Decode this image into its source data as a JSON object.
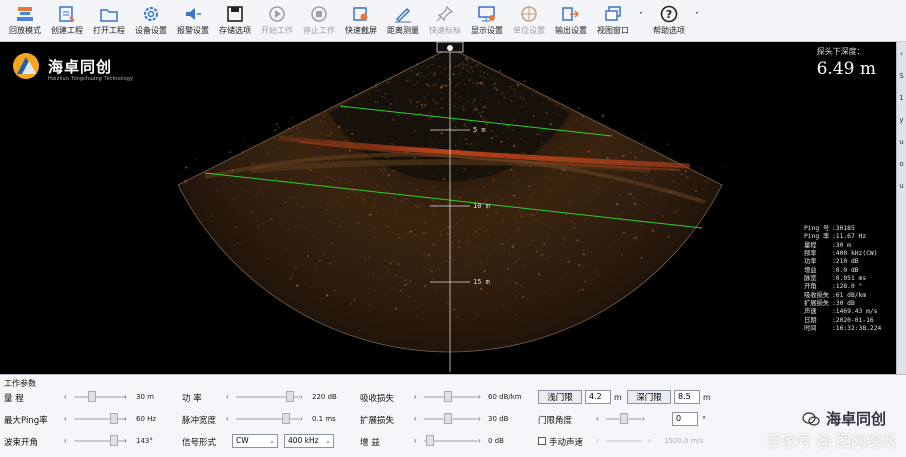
{
  "toolbar": [
    {
      "label": "回放模式",
      "icon": "user-playback-icon",
      "enabled": true
    },
    {
      "label": "创建工程",
      "icon": "new-project-icon",
      "enabled": true
    },
    {
      "label": "打开工程",
      "icon": "folder-open-icon",
      "enabled": true
    },
    {
      "label": "设备设置",
      "icon": "gear-icon",
      "enabled": true
    },
    {
      "label": "报警设置",
      "icon": "speaker-alarm-icon",
      "enabled": true
    },
    {
      "label": "存储选项",
      "icon": "save-icon",
      "enabled": true
    },
    {
      "label": "开始工作",
      "icon": "play-icon",
      "enabled": false
    },
    {
      "label": "停止工作",
      "icon": "stop-icon",
      "enabled": false
    },
    {
      "label": "快速截屏",
      "icon": "screenshot-icon",
      "enabled": true
    },
    {
      "label": "距离测量",
      "icon": "ruler-pen-icon",
      "enabled": true
    },
    {
      "label": "快速标标",
      "icon": "pin-mark-icon",
      "enabled": false
    },
    {
      "label": "显示设置",
      "icon": "display-settings-icon",
      "enabled": true
    },
    {
      "label": "单位设置",
      "icon": "crosshair-icon",
      "enabled": false
    },
    {
      "label": "输出设置",
      "icon": "export-icon",
      "enabled": true
    },
    {
      "label": "视图窗口",
      "icon": "window-icon",
      "enabled": true
    },
    {
      "label": "·",
      "icon": "more-dot-icon",
      "enabled": true
    },
    {
      "label": "帮助选项",
      "icon": "help-icon",
      "enabled": true
    },
    {
      "label": "·",
      "icon": "more-dot-icon",
      "enabled": true
    }
  ],
  "logo": {
    "brand": "海卓同创",
    "sub": "Haizhuo Tongchuang Technology"
  },
  "depth": {
    "label": "探头下深度：",
    "value": "6.49 m"
  },
  "range_labels": [
    "5 m",
    "10 m",
    "15 m"
  ],
  "info": [
    {
      "k": "Ping 号",
      "v": "30185"
    },
    {
      "k": "Ping 率",
      "v": "11.67 Hz"
    },
    {
      "k": "量程",
      "v": "30 m"
    },
    {
      "k": "频率",
      "v": "400 kHz(CW)"
    },
    {
      "k": "功率",
      "v": "210 dB"
    },
    {
      "k": "增益",
      "v": "0.0 dB"
    },
    {
      "k": "脉宽",
      "v": "0.051 ms"
    },
    {
      "k": "开角",
      "v": "128.0 °"
    },
    {
      "k": "吸收损失",
      "v": "61 dB/km"
    },
    {
      "k": "扩展损失",
      "v": "30 dB"
    },
    {
      "k": "声速",
      "v": "1469.43 m/s"
    },
    {
      "k": "日期",
      "v": "2020-01-16"
    },
    {
      "k": "时间",
      "v": "16:32:38.224"
    }
  ],
  "rightbar": [
    "‹",
    "S",
    "1",
    "y",
    "u",
    "o",
    "u"
  ],
  "panel": {
    "title": "工作参数",
    "row1": {
      "range_label": "量    程",
      "range_value": "30 m",
      "power_label": "功    率",
      "power_value": "220 dB",
      "absorb_label": "吸收损失",
      "absorb_value": "60 dB/km",
      "shallow_btn": "浅门限",
      "shallow_val": "4.2",
      "unit1": "m",
      "deep_btn": "深门限",
      "deep_val": "8.5",
      "unit2": "m"
    },
    "row2": {
      "ping_label": "最大Ping率",
      "ping_value": "60 Hz",
      "pulse_label": "脉冲宽度",
      "pulse_value": "0.1 ms",
      "spread_label": "扩展损失",
      "spread_value": "30 dB",
      "angle_label": "门限角度",
      "angle_val": "0",
      "angle_unit": "°"
    },
    "row3": {
      "beam_label": "波束开角",
      "beam_value": "143°",
      "signal_label": "信号形式",
      "signal_mode": "CW",
      "signal_freq": "400 kHz",
      "gain_label": "增    益",
      "gain_value": "0 dB",
      "manual_label": "手动声速",
      "manual_value": "1500.0 m/s"
    }
  },
  "watermark": {
    "brand": "海卓同创",
    "text": "百家号 @ 图网综网"
  },
  "colors": {
    "sonar_bg": "#000000",
    "echo": "#c7481e",
    "beam_line": "#2fd02a",
    "fan": "#3a2412"
  }
}
